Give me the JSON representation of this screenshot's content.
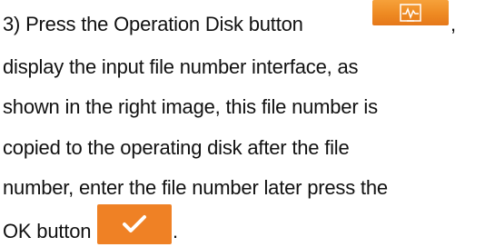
{
  "document": {
    "lines": [
      "3) Press the Operation Disk button",
      "display the input file number interface, as",
      "shown in the right image, this file number is",
      "copied to the operating disk after the file",
      "number, enter the file number later press the",
      "OK button"
    ],
    "comma_after_icon": ",",
    "period_after_icon": "."
  },
  "icons": {
    "operation_disk": "operation-disk-icon",
    "ok": "check-icon"
  },
  "colors": {
    "accent": "#ef8125",
    "text": "#111111"
  }
}
